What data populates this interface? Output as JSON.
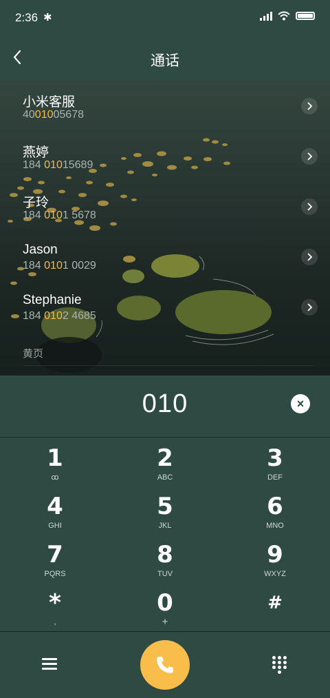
{
  "status": {
    "time": "2:36",
    "bluetooth": "✱"
  },
  "header": {
    "title": "通话",
    "back_icon": "back-arrow-icon"
  },
  "contacts": [
    {
      "name": "小米客服",
      "num_pre": "40",
      "num_hl": "010",
      "num_post": "05678"
    },
    {
      "name": "燕婷",
      "num_pre": "184 ",
      "num_hl": "010",
      "num_post": "15689"
    },
    {
      "name": "子玲",
      "num_pre": "184 ",
      "num_hl": "010",
      "num_post": "1 5678"
    },
    {
      "name": "Jason",
      "num_pre": "184 ",
      "num_hl": "010",
      "num_post": "1 0029"
    },
    {
      "name": "Stephanie",
      "num_pre": "184 ",
      "num_hl": "010",
      "num_post": "2 4685"
    }
  ],
  "yellow_pages": "黄页",
  "dial": {
    "value": "010",
    "clear": "×"
  },
  "keys": [
    {
      "digit": "1",
      "letters": "ꝏ"
    },
    {
      "digit": "2",
      "letters": "ABC"
    },
    {
      "digit": "3",
      "letters": "DEF"
    },
    {
      "digit": "4",
      "letters": "GHI"
    },
    {
      "digit": "5",
      "letters": "JKL"
    },
    {
      "digit": "6",
      "letters": "MNO"
    },
    {
      "digit": "7",
      "letters": "PQRS"
    },
    {
      "digit": "8",
      "letters": "TUV"
    },
    {
      "digit": "9",
      "letters": "WXYZ"
    },
    {
      "digit": "*",
      "letters": ","
    },
    {
      "digit": "0",
      "letters": "+"
    },
    {
      "digit": "#",
      "letters": ""
    }
  ],
  "colors": {
    "bar": "#2f4a43",
    "accent": "#f6bb42",
    "call": "#f8bd4b"
  }
}
